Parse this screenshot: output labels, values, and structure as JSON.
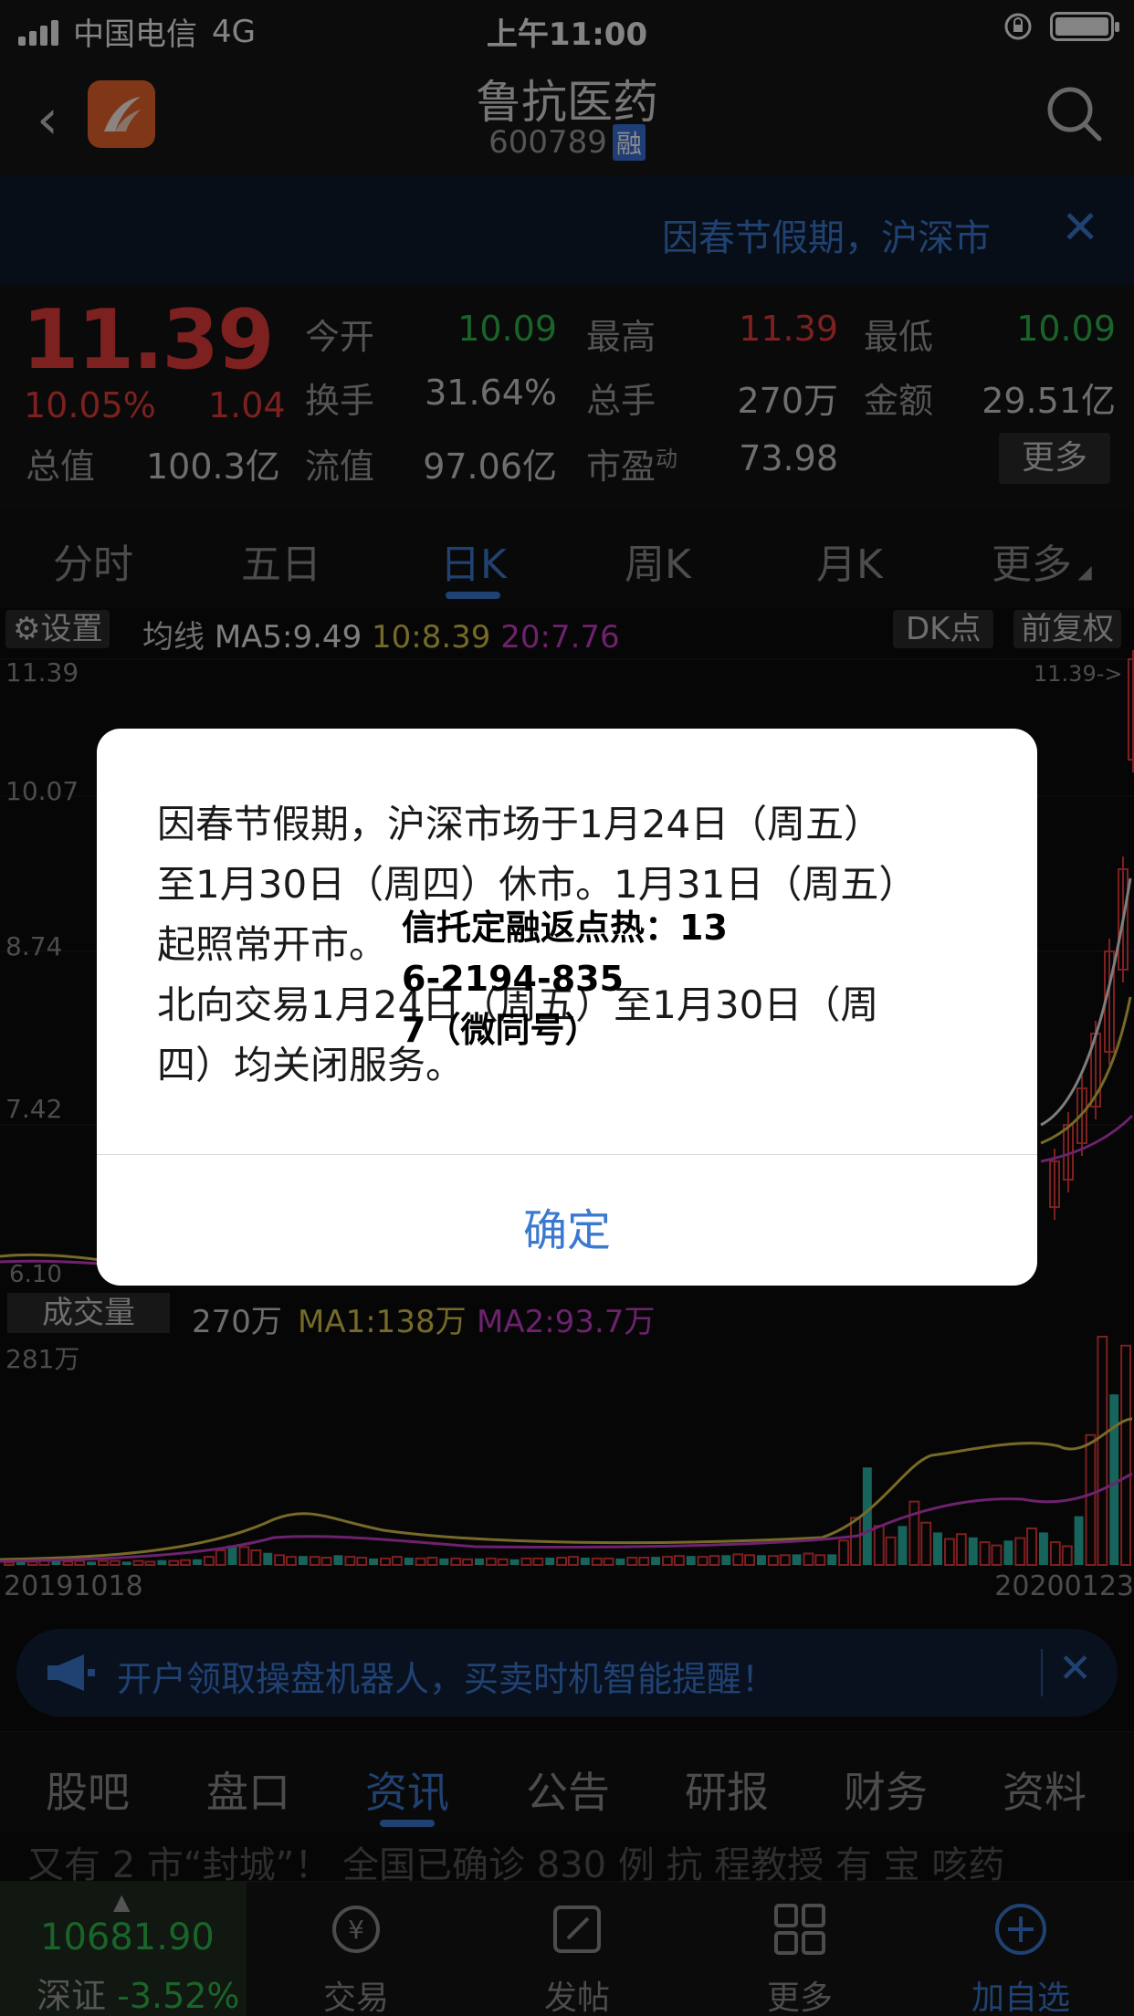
{
  "status_bar": {
    "carrier": "中国电信",
    "network": "4G",
    "time": "上午11:00"
  },
  "header": {
    "title": "鲁抗医药",
    "code": "600789",
    "margin_badge": "融"
  },
  "notice_banner": {
    "text": "因春节假期，沪深市"
  },
  "quote": {
    "price": "11.39",
    "change_pct": "10.05%",
    "change": "1.04",
    "total_value_label": "总值",
    "total_value": "100.3亿",
    "rows": [
      [
        {
          "label": "今开",
          "value": "10.09",
          "color": "green"
        },
        {
          "label": "最高",
          "value": "11.39",
          "color": "red"
        },
        {
          "label": "最低",
          "value": "10.09",
          "color": "green"
        }
      ],
      [
        {
          "label": "换手",
          "value": "31.64%",
          "color": "gray"
        },
        {
          "label": "总手",
          "value": "270万",
          "color": "gray"
        },
        {
          "label": "金额",
          "value": "29.51亿",
          "color": "gray"
        }
      ],
      [
        {
          "label": "流值",
          "value": "97.06亿",
          "color": "gray"
        },
        {
          "label": "市盈",
          "value": "73.98",
          "color": "gray",
          "superscript": "动"
        }
      ]
    ],
    "more_label": "更多"
  },
  "period_tabs": [
    "分时",
    "五日",
    "日K",
    "周K",
    "月K",
    "更多"
  ],
  "active_period_tab": 2,
  "chart_toolbar": {
    "settings_label": "设置",
    "ma_label": "均线",
    "ma5": "MA5:9.49",
    "ma10": "10:8.39",
    "ma20": "20:7.76",
    "dk_label": "DK点",
    "adjust_label": "前复权"
  },
  "price_axis": {
    "top": "11.39",
    "l1": "10.07",
    "l2": "8.74",
    "l3": "7.42",
    "bottom": "6.10",
    "marker": "11.39->"
  },
  "volume_toolbar": {
    "label": "成交量",
    "volume": "270万",
    "ma1": "MA1:138万",
    "ma2": "MA2:93.7万",
    "axis_top": "281万"
  },
  "dates": {
    "start": "20191018",
    "end": "20200123"
  },
  "ad_bar": {
    "text": "开户领取操盘机器人，买卖时机智能提醒！"
  },
  "info_tabs": [
    "股吧",
    "盘口",
    "资讯",
    "公告",
    "研报",
    "财务",
    "资料"
  ],
  "active_info_tab": 2,
  "news_peek": "又有 2 市“封城”！ 全国已确诊 830 例 抗 程教授 有 宝 咳药",
  "bottom_nav": {
    "index_value": "10681.90",
    "index_name": "深证",
    "index_change": "-3.52%",
    "items": [
      "交易",
      "发帖",
      "更多",
      "加自选"
    ]
  },
  "dialog": {
    "message_lines": [
      "因春节假期，沪深市场于1月24日（周五）",
      "至1月30日（周四）休市。1月31日（周五）",
      "起照常开市。",
      "北向交易1月24日（周五）至1月30日（周",
      "四）均关闭服务。"
    ],
    "ok_label": "确定"
  },
  "watermark_text": [
    "信托定融返点热：13",
    "6-2194-835",
    "7（微同号）"
  ],
  "colors": {
    "up": "#e33b3b",
    "down": "#2fb84c",
    "accent": "#3b79d0",
    "ma5": "#e6e6e6",
    "ma10": "#d8c24a",
    "ma20": "#c93fc9",
    "vol_down": "#2bb6a8"
  },
  "chart_data": {
    "type": "bar",
    "title": "",
    "xlabel": "",
    "ylabel": "",
    "x_range": [
      "20191018",
      "20200123"
    ],
    "ylim": [
      0,
      281
    ],
    "unit": "万",
    "series": [
      {
        "values": [
          3,
          5,
          4,
          5,
          5,
          4,
          5,
          4,
          5,
          5,
          4,
          5,
          4,
          6,
          5,
          6,
          7,
          10,
          18,
          24,
          22,
          18,
          15,
          12,
          10,
          11,
          10,
          9,
          12,
          10,
          9,
          8,
          8,
          10,
          9,
          8,
          9,
          8,
          8,
          7,
          8,
          8,
          7,
          7,
          8,
          8,
          9,
          9,
          10,
          9,
          8,
          8,
          8,
          9,
          9,
          10,
          10,
          11,
          11,
          10,
          11,
          12,
          13,
          12,
          12,
          11,
          12,
          13,
          14,
          12,
          13,
          30,
          58,
          120,
          48,
          34,
          48,
          78,
          52,
          40,
          32,
          38,
          34,
          28,
          24,
          30,
          33,
          45,
          40,
          28,
          23,
          60,
          160,
          281,
          210,
          270
        ]
      }
    ]
  }
}
